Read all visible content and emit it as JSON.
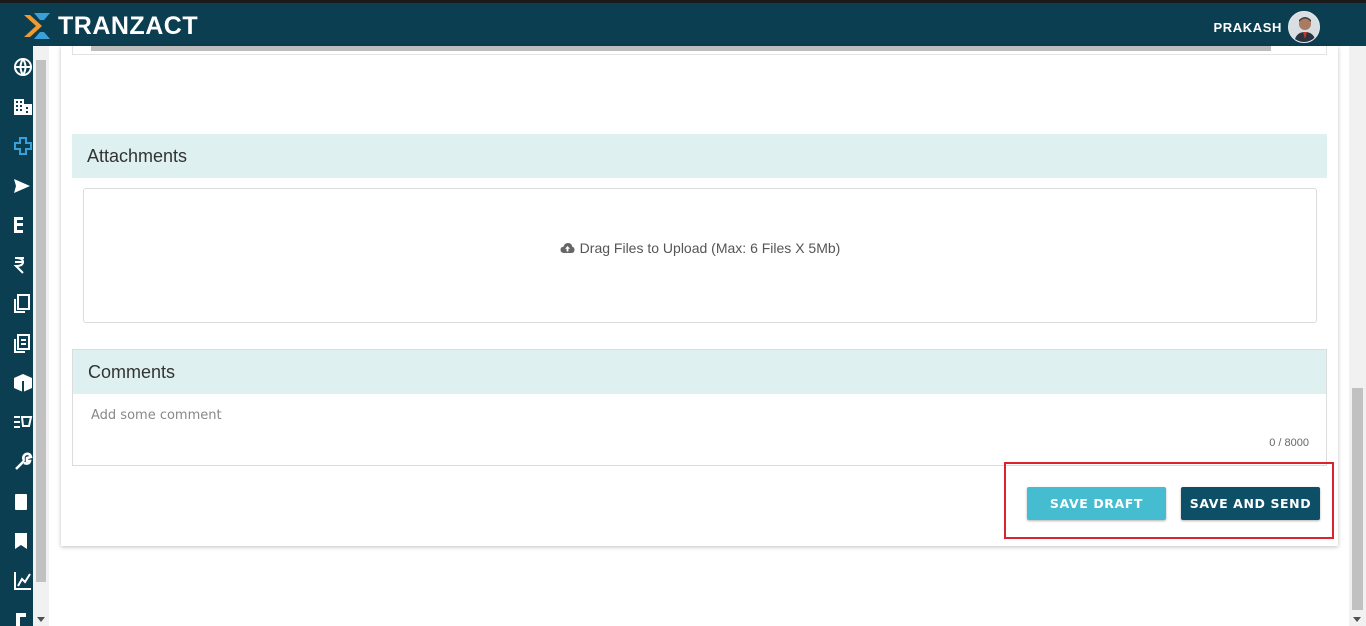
{
  "header": {
    "brand": "TRANZACT",
    "user_name": "PRAKASH",
    "colors": {
      "bar": "#0c3e51",
      "logo_orange": "#f29a2e",
      "logo_blue": "#3aa0d8"
    }
  },
  "sidebar": {
    "icons": [
      "globe-icon",
      "building-icon",
      "plus-icon",
      "send-icon",
      "list-icon",
      "rupee-icon",
      "copy-icon",
      "documents-icon",
      "package-icon",
      "cart-icon",
      "wrench-icon",
      "book-icon",
      "bookmark-icon",
      "chart-icon",
      "more-icon"
    ],
    "active_color": "#3aa0d8"
  },
  "attachments": {
    "title": "Attachments",
    "drop_text": "Drag Files to Upload (Max: 6 Files X 5Mb)"
  },
  "comments": {
    "title": "Comments",
    "placeholder": "Add some comment",
    "counter": "0 / 8000"
  },
  "actions": {
    "save_draft": "SAVE DRAFT",
    "save_and_send": "SAVE AND SEND",
    "highlight_color": "#d9232e"
  }
}
